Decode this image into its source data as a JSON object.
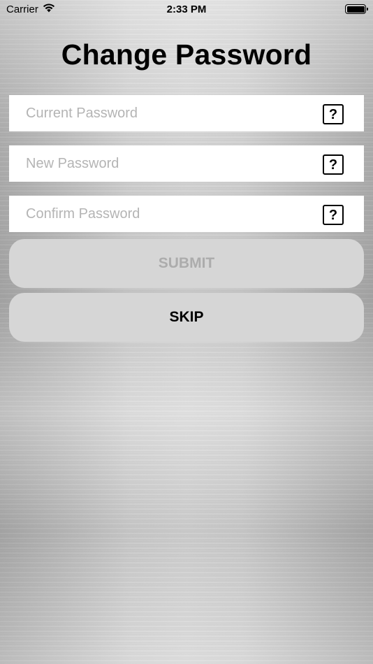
{
  "status_bar": {
    "carrier": "Carrier",
    "time": "2:33 PM",
    "battery_level": 1.0
  },
  "title": "Change Password",
  "fields": {
    "current": {
      "placeholder": "Current Password",
      "help_glyph": "?"
    },
    "new": {
      "placeholder": "New Password",
      "help_glyph": "?"
    },
    "confirm": {
      "placeholder": "Confirm Password",
      "help_glyph": "?"
    }
  },
  "buttons": {
    "submit": "SUBMIT",
    "skip": "SKIP"
  },
  "colors": {
    "button_bg": "#d6d6d6",
    "submit_disabled_text": "#acacac",
    "placeholder": "#b4b4b4"
  }
}
